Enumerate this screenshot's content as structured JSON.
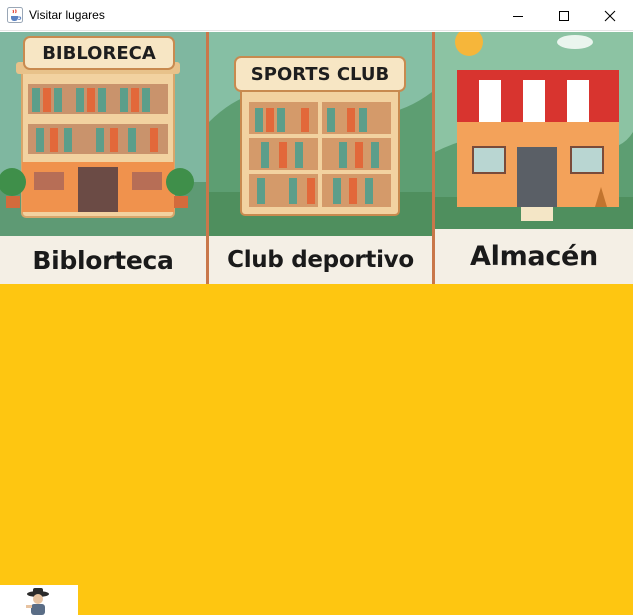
{
  "window": {
    "title": "Visitar lugares",
    "app_icon": "java-cup-icon",
    "controls": [
      "minimize-icon",
      "maximize-icon",
      "close-icon"
    ]
  },
  "places": [
    {
      "id": "biblioteca",
      "sign": "BIBLORECA",
      "label": "Biblorteca"
    },
    {
      "id": "club",
      "sign": "SPORTS CLUB",
      "label": "Club deportivo"
    },
    {
      "id": "almacen",
      "sign": "",
      "label": "Almacén"
    }
  ],
  "colors": {
    "background": "#fec611",
    "card_divider": "#c9774a",
    "label_bg": "#f4efe5"
  },
  "player": {
    "icon": "character-avatar-icon"
  }
}
